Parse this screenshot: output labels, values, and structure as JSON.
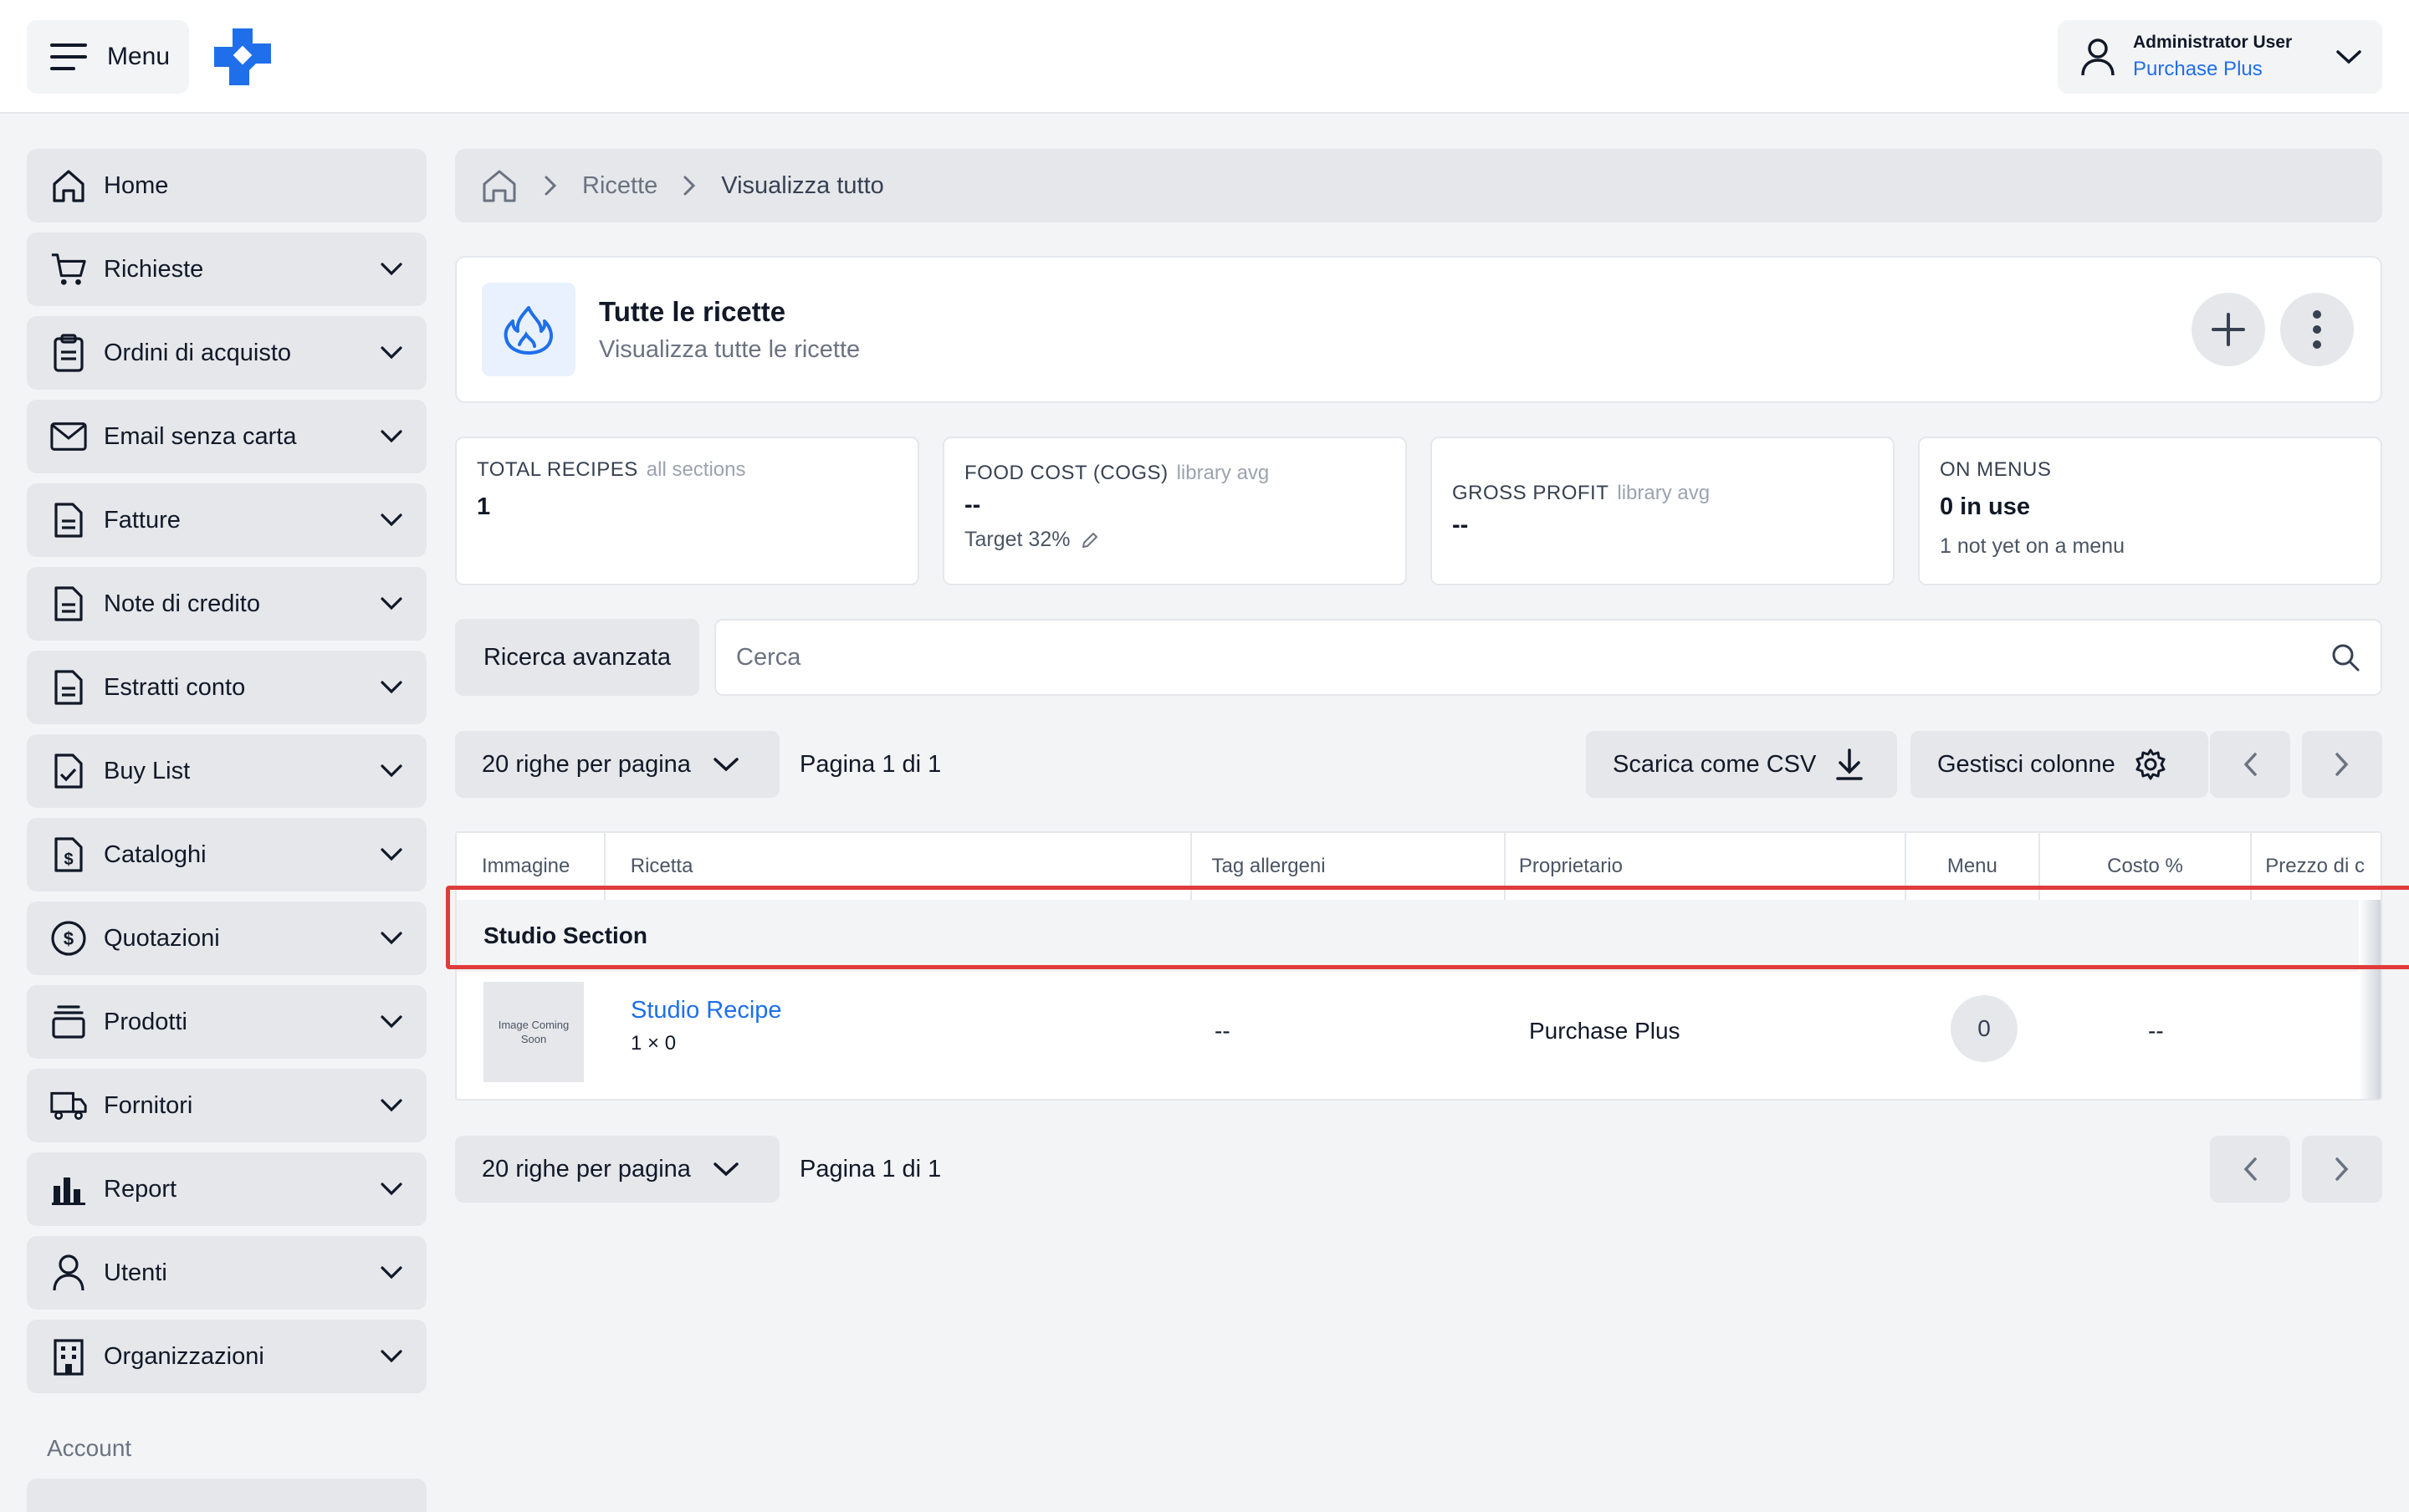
{
  "topbar": {
    "menu_label": "Menu",
    "user_name": "Administrator User",
    "user_org": "Purchase Plus",
    "brand_color": "#1f6feb"
  },
  "sidebar": {
    "items": [
      {
        "label": "Home",
        "icon": "home-icon"
      },
      {
        "label": "Richieste",
        "icon": "cart-icon"
      },
      {
        "label": "Ordini di acquisto",
        "icon": "clipboard-icon"
      },
      {
        "label": "Email senza carta",
        "icon": "mail-icon"
      },
      {
        "label": "Fatture",
        "icon": "document-icon"
      },
      {
        "label": "Note di credito",
        "icon": "document-icon"
      },
      {
        "label": "Estratti conto",
        "icon": "document-icon"
      },
      {
        "label": "Buy List",
        "icon": "checklist-icon"
      },
      {
        "label": "Cataloghi",
        "icon": "dollar-document-icon"
      },
      {
        "label": "Quotazioni",
        "icon": "dollar-circle-icon"
      },
      {
        "label": "Prodotti",
        "icon": "stack-icon"
      },
      {
        "label": "Fornitori",
        "icon": "truck-icon"
      },
      {
        "label": "Report",
        "icon": "bar-chart-icon"
      },
      {
        "label": "Utenti",
        "icon": "user-icon"
      },
      {
        "label": "Organizzazioni",
        "icon": "building-icon"
      }
    ],
    "account_section": "Account"
  },
  "breadcrumb": {
    "items": [
      "Ricette",
      "Visualizza tutto"
    ]
  },
  "header": {
    "title": "Tutte le ricette",
    "subtitle": "Visualizza tutte le ricette"
  },
  "stats": [
    {
      "label": "TOTAL RECIPES",
      "qualifier": "all sections",
      "value": "1",
      "note": ""
    },
    {
      "label": "FOOD COST (COGS)",
      "qualifier": "library avg",
      "value": "--",
      "note": "Target 32%"
    },
    {
      "label": "GROSS PROFIT",
      "qualifier": "library avg",
      "value": "--",
      "note": ""
    },
    {
      "label": "ON MENUS",
      "qualifier": "",
      "value": "0 in use",
      "note": "1 not yet on a menu"
    }
  ],
  "search": {
    "advanced_label": "Ricerca avanzata",
    "placeholder": "Cerca"
  },
  "toolbar": {
    "rows_per_page": "20 righe per pagina",
    "page_info": "Pagina 1 di 1",
    "csv_label": "Scarica come CSV",
    "columns_label": "Gestisci colonne"
  },
  "table": {
    "columns": [
      "Immagine",
      "Ricetta",
      "Tag allergeni",
      "Proprietario",
      "Menu",
      "Costo %",
      "Prezzo di c"
    ],
    "group": "Studio Section",
    "row": {
      "image_placeholder": "Image Coming Soon",
      "recipe_name": "Studio Recipe",
      "recipe_meta": "1 × 0",
      "allergens": "--",
      "owner": "Purchase Plus",
      "menu_count": "0",
      "cost_pct": "--"
    }
  },
  "footer": {
    "rows_per_page": "20 righe per pagina",
    "page_info": "Pagina 1 di 1"
  }
}
